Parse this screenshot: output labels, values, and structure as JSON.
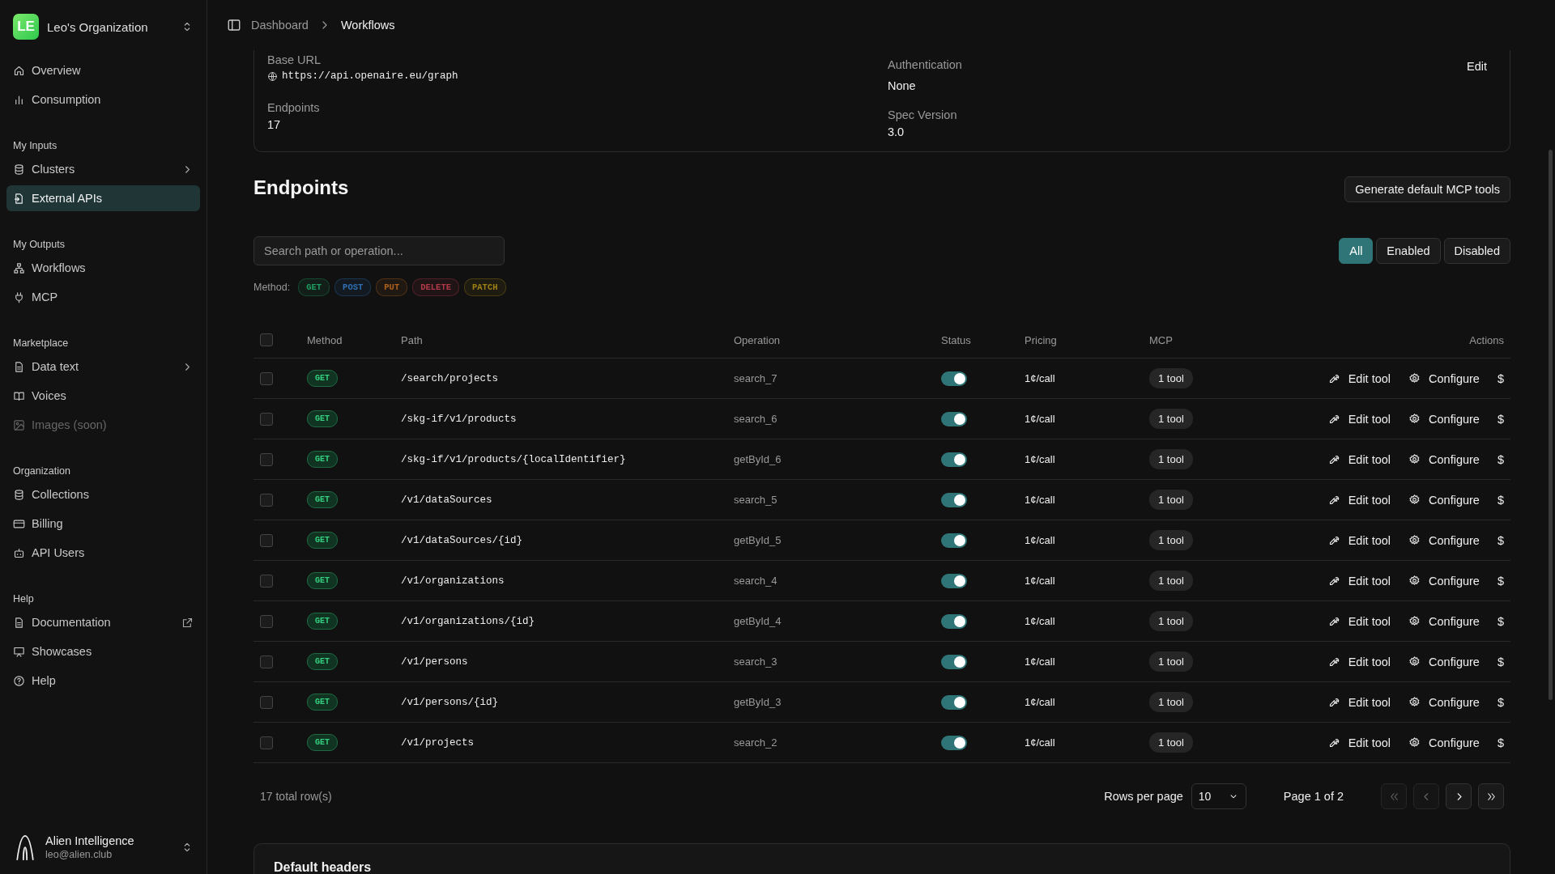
{
  "org": {
    "initials": "LE",
    "name": "Leo's Organization"
  },
  "sidebar": {
    "groups": [
      {
        "items": [
          {
            "label": "Overview",
            "selected": false,
            "disabled": false,
            "submenu": false,
            "external": false
          },
          {
            "label": "Consumption",
            "selected": false,
            "disabled": false,
            "submenu": false,
            "external": false
          }
        ]
      },
      {
        "title": "My Inputs",
        "items": [
          {
            "label": "Clusters",
            "selected": false,
            "disabled": false,
            "submenu": true,
            "external": false
          },
          {
            "label": "External APIs",
            "selected": true,
            "disabled": false,
            "submenu": false,
            "external": false
          }
        ]
      },
      {
        "title": "My Outputs",
        "items": [
          {
            "label": "Workflows",
            "selected": false,
            "disabled": false,
            "submenu": false,
            "external": false
          },
          {
            "label": "MCP",
            "selected": false,
            "disabled": false,
            "submenu": false,
            "external": false
          }
        ]
      },
      {
        "title": "Marketplace",
        "items": [
          {
            "label": "Data text",
            "selected": false,
            "disabled": false,
            "submenu": true,
            "external": false
          },
          {
            "label": "Voices",
            "selected": false,
            "disabled": false,
            "submenu": false,
            "external": false
          },
          {
            "label": "Images (soon)",
            "selected": false,
            "disabled": true,
            "submenu": false,
            "external": false
          }
        ]
      },
      {
        "title": "Organization",
        "items": [
          {
            "label": "Collections",
            "selected": false,
            "disabled": false,
            "submenu": false,
            "external": false
          },
          {
            "label": "Billing",
            "selected": false,
            "disabled": false,
            "submenu": false,
            "external": false
          },
          {
            "label": "API Users",
            "selected": false,
            "disabled": false,
            "submenu": false,
            "external": false
          }
        ]
      },
      {
        "title": "Help",
        "items": [
          {
            "label": "Documentation",
            "selected": false,
            "disabled": false,
            "submenu": false,
            "external": true
          },
          {
            "label": "Showcases",
            "selected": false,
            "disabled": false,
            "submenu": false,
            "external": false
          },
          {
            "label": "Help",
            "selected": false,
            "disabled": false,
            "submenu": false,
            "external": false
          }
        ]
      }
    ]
  },
  "user": {
    "name": "Alien Intelligence",
    "email": "leo@alien.club"
  },
  "breadcrumb": [
    "Dashboard",
    "Workflows"
  ],
  "details": {
    "base_url_label": "Base URL",
    "base_url": "https://api.openaire.eu/graph",
    "auth_label": "Authentication",
    "auth": "None",
    "edit": "Edit",
    "endpoints_label": "Endpoints",
    "endpoints": "17",
    "spec_label": "Spec Version",
    "spec": "3.0"
  },
  "endpoints": {
    "title": "Endpoints",
    "generate_button": "Generate default MCP tools",
    "search": {
      "placeholder": "Search path or operation..."
    },
    "filters": [
      {
        "label": "All",
        "selected": true
      },
      {
        "label": "Enabled",
        "selected": false
      },
      {
        "label": "Disabled",
        "selected": false
      }
    ],
    "method_label": "Method:",
    "methods": [
      {
        "label": "GET",
        "color": "#1f9d62"
      },
      {
        "label": "POST",
        "color": "#2f6fb3"
      },
      {
        "label": "PUT",
        "color": "#b0621c"
      },
      {
        "label": "DELETE",
        "color": "#b03a48"
      },
      {
        "label": "PATCH",
        "color": "#a08214"
      }
    ],
    "table": {
      "select_all_checked": false,
      "columns": [
        "Method",
        "Path",
        "Operation",
        "Status",
        "Pricing",
        "MCP",
        "Actions"
      ],
      "rows": [
        {
          "checked": false,
          "method": "GET",
          "path": "/search/projects",
          "operation": "search_7",
          "on": true,
          "pricing": "1¢/call",
          "mcp": "1 tool",
          "actions": [
            "Edit tool",
            "Configure",
            "$"
          ]
        },
        {
          "checked": false,
          "method": "GET",
          "path": "/skg-if/v1/products",
          "operation": "search_6",
          "on": true,
          "pricing": "1¢/call",
          "mcp": "1 tool",
          "actions": [
            "Edit tool",
            "Configure",
            "$"
          ]
        },
        {
          "checked": false,
          "method": "GET",
          "path": "/skg-if/v1/products/{localIdentifier}",
          "operation": "getById_6",
          "on": true,
          "pricing": "1¢/call",
          "mcp": "1 tool",
          "actions": [
            "Edit tool",
            "Configure",
            "$"
          ]
        },
        {
          "checked": false,
          "method": "GET",
          "path": "/v1/dataSources",
          "operation": "search_5",
          "on": true,
          "pricing": "1¢/call",
          "mcp": "1 tool",
          "actions": [
            "Edit tool",
            "Configure",
            "$"
          ]
        },
        {
          "checked": false,
          "method": "GET",
          "path": "/v1/dataSources/{id}",
          "operation": "getById_5",
          "on": true,
          "pricing": "1¢/call",
          "mcp": "1 tool",
          "actions": [
            "Edit tool",
            "Configure",
            "$"
          ]
        },
        {
          "checked": false,
          "method": "GET",
          "path": "/v1/organizations",
          "operation": "search_4",
          "on": true,
          "pricing": "1¢/call",
          "mcp": "1 tool",
          "actions": [
            "Edit tool",
            "Configure",
            "$"
          ]
        },
        {
          "checked": false,
          "method": "GET",
          "path": "/v1/organizations/{id}",
          "operation": "getById_4",
          "on": true,
          "pricing": "1¢/call",
          "mcp": "1 tool",
          "actions": [
            "Edit tool",
            "Configure",
            "$"
          ]
        },
        {
          "checked": false,
          "method": "GET",
          "path": "/v1/persons",
          "operation": "search_3",
          "on": true,
          "pricing": "1¢/call",
          "mcp": "1 tool",
          "actions": [
            "Edit tool",
            "Configure",
            "$"
          ]
        },
        {
          "checked": false,
          "method": "GET",
          "path": "/v1/persons/{id}",
          "operation": "getById_3",
          "on": true,
          "pricing": "1¢/call",
          "mcp": "1 tool",
          "actions": [
            "Edit tool",
            "Configure",
            "$"
          ]
        },
        {
          "checked": false,
          "method": "GET",
          "path": "/v1/projects",
          "operation": "search_2",
          "on": true,
          "pricing": "1¢/call",
          "mcp": "1 tool",
          "actions": [
            "Edit tool",
            "Configure",
            "$"
          ]
        }
      ]
    },
    "pagination": {
      "total": "17 total row(s)",
      "rows_per_page_label": "Rows per page",
      "rows_per_page": "10",
      "page": "Page 1 of 2",
      "first_disabled": true,
      "prev_disabled": true,
      "next_disabled": false,
      "last_disabled": false
    }
  },
  "default_headers": {
    "title": "Default headers"
  }
}
